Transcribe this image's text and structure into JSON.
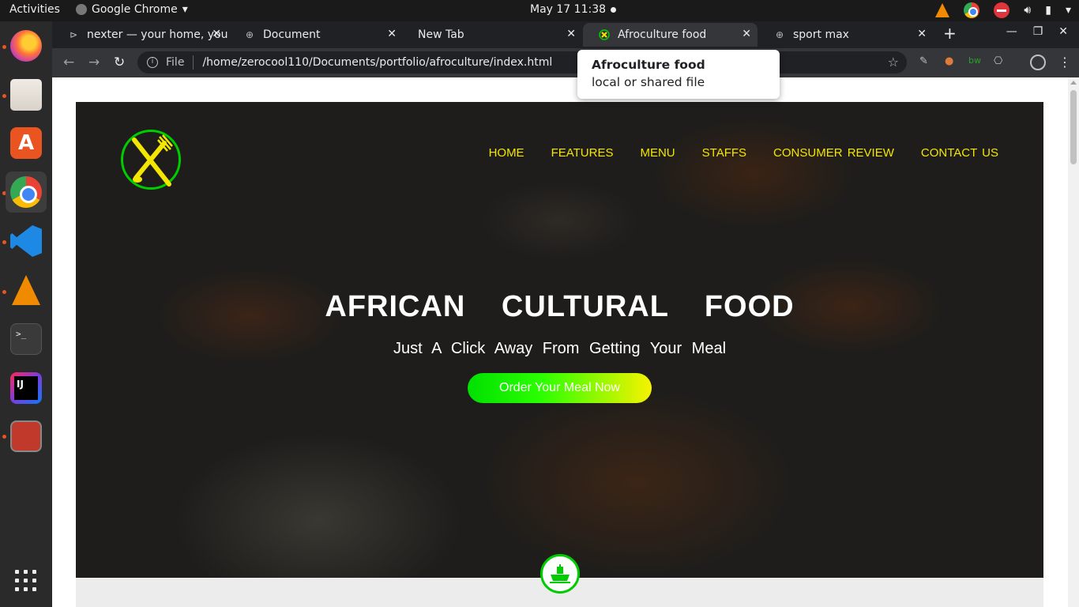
{
  "topbar": {
    "activities": "Activities",
    "app_name": "Google Chrome",
    "clock": "May 17  11:38"
  },
  "tabs": [
    {
      "title": "nexter — your home, your freedom",
      "icon": "play-chevron-icon"
    },
    {
      "title": "Document",
      "icon": "globe-icon"
    },
    {
      "title": "New Tab",
      "icon": "none"
    },
    {
      "title": "Afroculture food",
      "icon": "fork-knife-logo-icon",
      "active": true
    },
    {
      "title": "sport max",
      "icon": "globe-icon"
    }
  ],
  "omnibox": {
    "scheme": "File",
    "url": "/home/zerocool110/Documents/portfolio/afroculture/index.html"
  },
  "tooltip": {
    "title": "Afroculture food",
    "subtitle": "local or shared file"
  },
  "site": {
    "nav": [
      "HOME",
      "FEATURES",
      "MENU",
      "STAFFS",
      "CONSUMER  REVIEW",
      "CONTACT  US"
    ],
    "headline": "AFRICAN CULTURAL FOOD",
    "subline": "Just A Click Away From Getting Your Meal",
    "cta": "Order Your Meal Now",
    "colors": {
      "nav": "#f3e600",
      "logo_ring": "#00cc00",
      "cta_start": "#00e000",
      "cta_end": "#f7f200"
    }
  },
  "dock": [
    "firefox",
    "files",
    "ubuntu-software",
    "google-chrome",
    "vscode",
    "vlc",
    "terminal",
    "intellij",
    "red-app",
    "show-applications"
  ]
}
